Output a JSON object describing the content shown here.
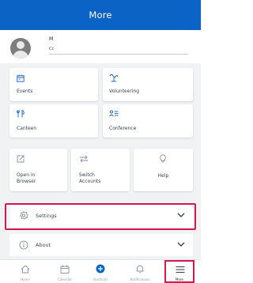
{
  "header": {
    "title": "More"
  },
  "profile": {
    "name": "M",
    "sub": "Cc"
  },
  "grid": {
    "events": "Events",
    "volunteering": "Volunteering",
    "canteen": "Canteen",
    "conference": "Conference"
  },
  "actions": {
    "open_in_browser_line1": "Open in",
    "open_in_browser_line2": "Browser",
    "switch_accounts_line1": "Switch",
    "switch_accounts_line2": "Accounts",
    "help": "Help"
  },
  "rows": {
    "settings": "Settings",
    "about": "About"
  },
  "tabs": [
    {
      "label": "Home"
    },
    {
      "label": "Calendar"
    },
    {
      "label": "Shortcuts"
    },
    {
      "label": "Notifications"
    },
    {
      "label": "More"
    }
  ],
  "colors": {
    "header": "#0b63c6",
    "highlight": "#d1184f",
    "accent": "#0b63c6"
  }
}
